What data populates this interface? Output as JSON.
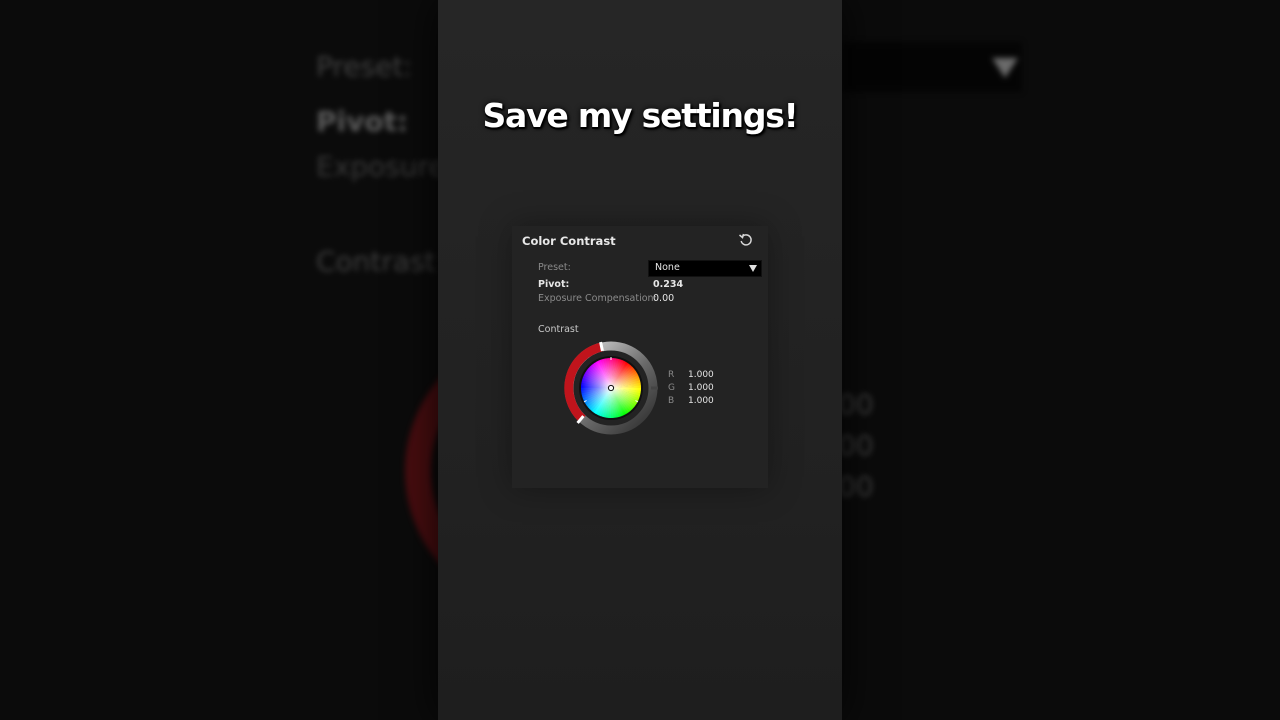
{
  "caption": "Save my settings!",
  "panel": {
    "title": "Color Contrast",
    "reset_icon": "reset-icon",
    "preset_label": "Preset:",
    "preset_value": "None",
    "pivot_label": "Pivot:",
    "pivot_value": "0.234",
    "exposure_label": "Exposure Compensation:",
    "exposure_value": "0.00",
    "section_label": "Contrast",
    "rgb": [
      {
        "label": "R",
        "value": "1.000"
      },
      {
        "label": "G",
        "value": "1.000"
      },
      {
        "label": "B",
        "value": "1.000"
      }
    ]
  },
  "backdrop": {
    "preset_label": "Preset:",
    "pivot_label": "Pivot:",
    "exposure_label": "Exposure",
    "section_label": "Contrast",
    "v1": "00",
    "v2": "00",
    "v3": "00"
  },
  "colors": {
    "frame_bg": "#232323",
    "dropdown_bg": "#000000",
    "ring_red": "#c0141c",
    "ring_white": "#e0e0e0"
  }
}
